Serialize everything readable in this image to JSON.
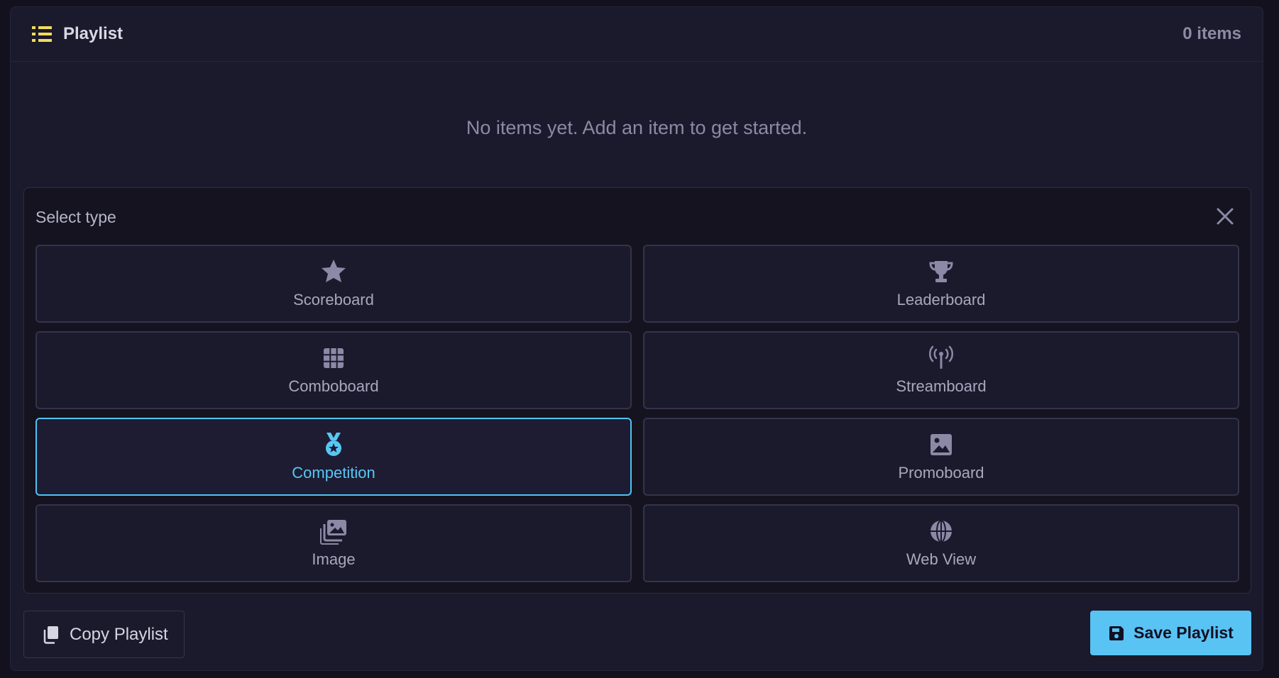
{
  "header": {
    "title": "Playlist",
    "count": "0 items",
    "icon": "list-icon",
    "icon_color": "#f2dc59"
  },
  "empty_state": "No items yet. Add an item to get started.",
  "selector": {
    "title": "Select type",
    "close_icon": "close-icon",
    "selected": "Competition",
    "types": [
      {
        "label": "Scoreboard",
        "icon": "star-icon"
      },
      {
        "label": "Leaderboard",
        "icon": "trophy-icon"
      },
      {
        "label": "Comboboard",
        "icon": "grid-icon"
      },
      {
        "label": "Streamboard",
        "icon": "broadcast-icon"
      },
      {
        "label": "Competition",
        "icon": "medal-icon"
      },
      {
        "label": "Promoboard",
        "icon": "image-icon"
      },
      {
        "label": "Image",
        "icon": "images-icon"
      },
      {
        "label": "Web View",
        "icon": "globe-icon"
      }
    ]
  },
  "footer": {
    "copy_label": "Copy Playlist",
    "copy_icon": "copy-icon",
    "save_label": "Save Playlist",
    "save_icon": "save-icon"
  },
  "colors": {
    "background": "#12111d",
    "panel": "#1b1a2c",
    "accent": "#59c3f4",
    "icon_default": "#8a89a6"
  }
}
